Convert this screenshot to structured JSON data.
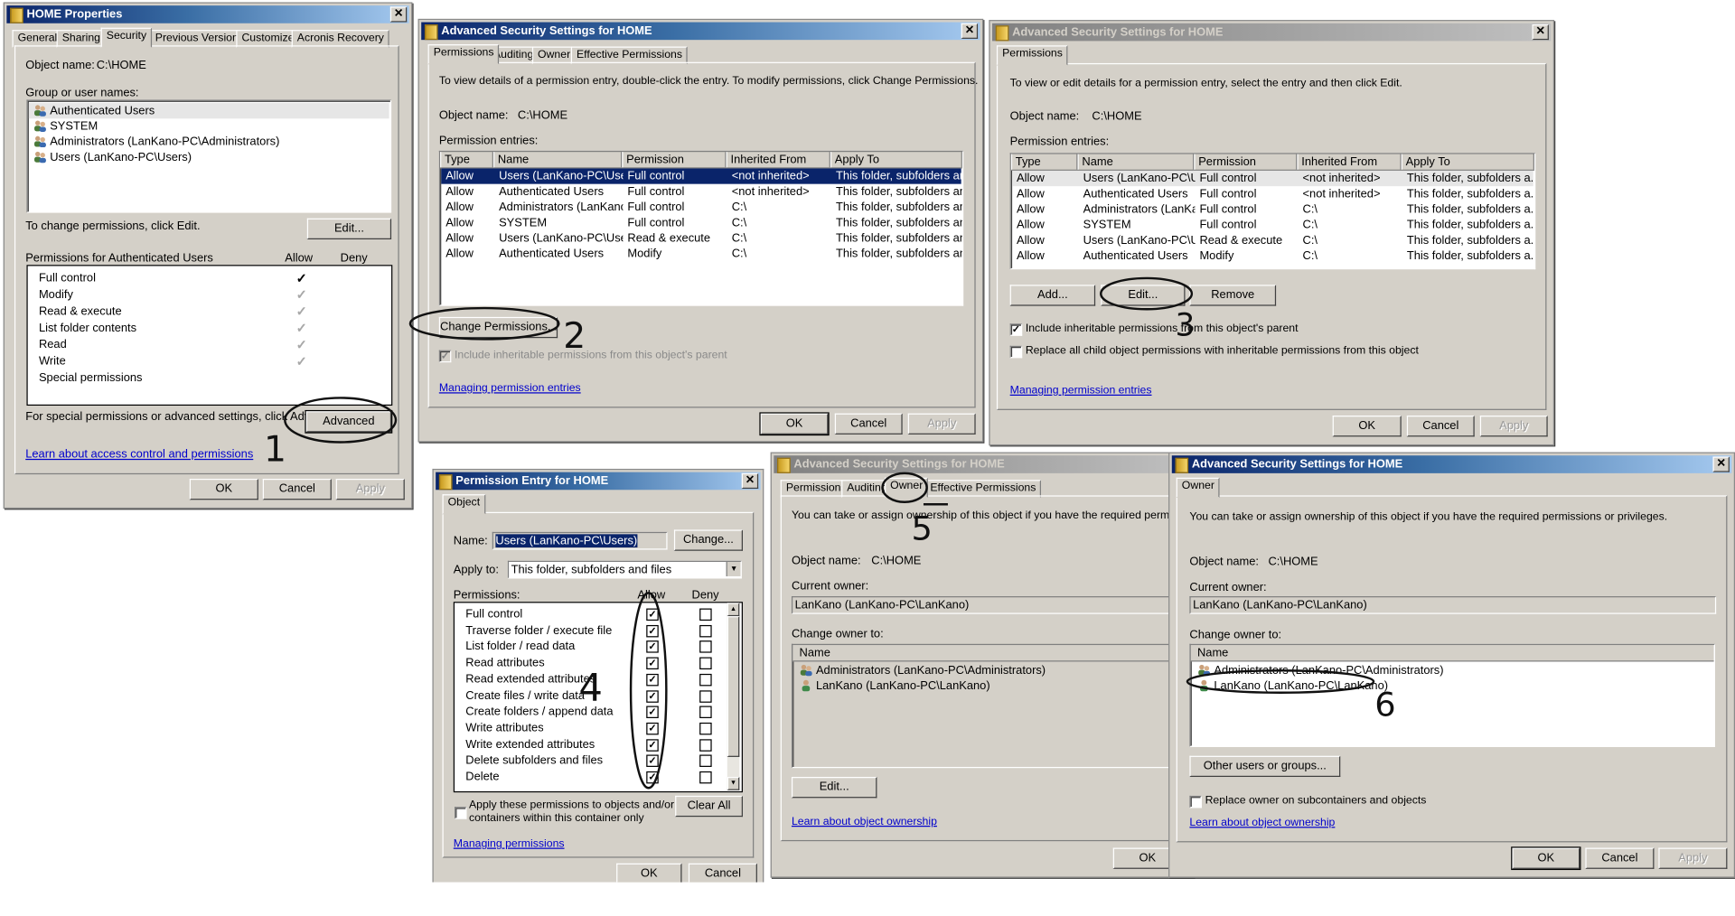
{
  "home_properties": {
    "title": "HOME Properties",
    "tabs": [
      "General",
      "Sharing",
      "Security",
      "Previous Versions",
      "Customize",
      "Acronis Recovery"
    ],
    "active_tab": "Security",
    "object_name_label": "Object name:",
    "object_name": "C:\\HOME",
    "group_label": "Group or user names:",
    "users": [
      "Authenticated Users",
      "SYSTEM",
      "Administrators (LanKano-PC\\Administrators)",
      "Users (LanKano-PC\\Users)"
    ],
    "change_hint": "To change permissions, click Edit.",
    "edit_button": "Edit...",
    "permissions_label": "Permissions for Authenticated Users",
    "allow_header": "Allow",
    "deny_header": "Deny",
    "permissions": [
      {
        "name": "Full control",
        "allow": "explicit"
      },
      {
        "name": "Modify",
        "allow": "inherited"
      },
      {
        "name": "Read & execute",
        "allow": "inherited"
      },
      {
        "name": "List folder contents",
        "allow": "inherited"
      },
      {
        "name": "Read",
        "allow": "inherited"
      },
      {
        "name": "Write",
        "allow": "inherited"
      },
      {
        "name": "Special permissions",
        "allow": "none"
      }
    ],
    "advanced_hint": "For special permissions or advanced settings, click Advanced.",
    "advanced_button": "Advanced",
    "help_link": "Learn about access control and permissions",
    "ok": "OK",
    "cancel": "Cancel",
    "apply": "Apply"
  },
  "adv_permissions": {
    "title": "Advanced Security Settings for HOME",
    "tabs": [
      "Permissions",
      "Auditing",
      "Owner",
      "Effective Permissions"
    ],
    "intro": "To view details of a permission entry, double-click the entry. To modify permissions, click Change Permissions.",
    "object_name_label": "Object name:",
    "object_name": "C:\\HOME",
    "entries_label": "Permission entries:",
    "columns": [
      "Type",
      "Name",
      "Permission",
      "Inherited From",
      "Apply To"
    ],
    "rows": [
      [
        "Allow",
        "Users (LanKano-PC\\Users)",
        "Full control",
        "<not inherited>",
        "This folder, subfolders and..."
      ],
      [
        "Allow",
        "Authenticated Users",
        "Full control",
        "<not inherited>",
        "This folder, subfolders and..."
      ],
      [
        "Allow",
        "Administrators (LanKano-...",
        "Full control",
        "C:\\",
        "This folder, subfolders and..."
      ],
      [
        "Allow",
        "SYSTEM",
        "Full control",
        "C:\\",
        "This folder, subfolders and..."
      ],
      [
        "Allow",
        "Users (LanKano-PC\\Users)",
        "Read & execute",
        "C:\\",
        "This folder, subfolders and..."
      ],
      [
        "Allow",
        "Authenticated Users",
        "Modify",
        "C:\\",
        "This folder, subfolders and..."
      ]
    ],
    "change_button": "Change Permissions...",
    "include_inheritable": "Include inheritable permissions from this object's parent",
    "link": "Managing permission entries",
    "ok": "OK",
    "cancel": "Cancel",
    "apply": "Apply"
  },
  "adv_permissions_edit": {
    "title": "Advanced Security Settings for HOME",
    "tabs": [
      "Permissions"
    ],
    "intro": "To view or edit details for a permission entry, select the entry and then click Edit.",
    "object_name_label": "Object name:",
    "object_name": "C:\\HOME",
    "entries_label": "Permission entries:",
    "columns": [
      "Type",
      "Name",
      "Permission",
      "Inherited From",
      "Apply To"
    ],
    "rows": [
      [
        "Allow",
        "Users (LanKano-PC\\Users)",
        "Full control",
        "<not inherited>",
        "This folder, subfolders a..."
      ],
      [
        "Allow",
        "Authenticated Users",
        "Full control",
        "<not inherited>",
        "This folder, subfolders a..."
      ],
      [
        "Allow",
        "Administrators (LanKano...",
        "Full control",
        "C:\\",
        "This folder, subfolders a..."
      ],
      [
        "Allow",
        "SYSTEM",
        "Full control",
        "C:\\",
        "This folder, subfolders a..."
      ],
      [
        "Allow",
        "Users (LanKano-PC\\Users)",
        "Read & execute",
        "C:\\",
        "This folder, subfolders a..."
      ],
      [
        "Allow",
        "Authenticated Users",
        "Modify",
        "C:\\",
        "This folder, subfolders a..."
      ]
    ],
    "add": "Add...",
    "edit": "Edit...",
    "remove": "Remove",
    "include_inheritable": "Include inheritable permissions from this object's parent",
    "replace_child": "Replace all child object permissions with inheritable permissions from this object",
    "link": "Managing permission entries",
    "ok": "OK",
    "cancel": "Cancel",
    "apply": "Apply"
  },
  "permission_entry": {
    "title": "Permission Entry for HOME",
    "tab": "Object",
    "name_label": "Name:",
    "name_value": "Users (LanKano-PC\\Users)",
    "change": "Change...",
    "apply_to_label": "Apply to:",
    "apply_to": "This folder, subfolders and files",
    "permissions_label": "Permissions:",
    "allow_header": "Allow",
    "deny_header": "Deny",
    "permissions": [
      {
        "name": "Full control",
        "allow": true,
        "deny": false
      },
      {
        "name": "Traverse folder / execute file",
        "allow": true,
        "deny": false
      },
      {
        "name": "List folder / read data",
        "allow": true,
        "deny": false
      },
      {
        "name": "Read attributes",
        "allow": true,
        "deny": false
      },
      {
        "name": "Read extended attributes",
        "allow": true,
        "deny": false
      },
      {
        "name": "Create files / write data",
        "allow": true,
        "deny": false
      },
      {
        "name": "Create folders / append data",
        "allow": true,
        "deny": false
      },
      {
        "name": "Write attributes",
        "allow": true,
        "deny": false
      },
      {
        "name": "Write extended attributes",
        "allow": true,
        "deny": false
      },
      {
        "name": "Delete subfolders and files",
        "allow": true,
        "deny": false
      },
      {
        "name": "Delete",
        "allow": true,
        "deny": false
      }
    ],
    "apply_only_line1": "Apply these permissions to objects and/or",
    "apply_only_line2": "containers within this container only",
    "clear_all": "Clear All",
    "link": "Managing permissions",
    "ok": "OK",
    "cancel": "Cancel"
  },
  "adv_owner_tab": {
    "title": "Advanced Security Settings for HOME",
    "tabs": [
      "Permissions",
      "Auditing",
      "Owner",
      "Effective Permissions"
    ],
    "intro": "You can take or assign ownership of this object if you have the required permissions or p",
    "object_name_label": "Object name:",
    "object_name": "C:\\HOME",
    "current_owner_label": "Current owner:",
    "current_owner": "LanKano (LanKano-PC\\LanKano)",
    "change_owner_label": "Change owner to:",
    "name_header": "Name",
    "owners": [
      {
        "name": "Administrators (LanKano-PC\\Administrators)",
        "icon": "group"
      },
      {
        "name": "LanKano (LanKano-PC\\LanKano)",
        "icon": "user"
      }
    ],
    "edit": "Edit...",
    "link": "Learn about object ownership",
    "ok": "OK"
  },
  "owner_only": {
    "title": "Advanced Security Settings for HOME",
    "tab": "Owner",
    "intro": "You can take or assign ownership of this object if you have the required permissions or privileges.",
    "object_name_label": "Object name:",
    "object_name": "C:\\HOME",
    "current_owner_label": "Current owner:",
    "current_owner": "LanKano (LanKano-PC\\LanKano)",
    "change_owner_label": "Change owner to:",
    "name_header": "Name",
    "owners": [
      {
        "name": "Administrators (LanKano-PC\\Administrators)",
        "icon": "group"
      },
      {
        "name": "LanKano (LanKano-PC\\LanKano)",
        "icon": "user"
      }
    ],
    "other_users": "Other users or groups...",
    "replace_owner": "Replace owner on subcontainers and objects",
    "link": "Learn about object ownership",
    "ok": "OK",
    "cancel": "Cancel",
    "apply": "Apply"
  },
  "annotations": [
    "1",
    "2",
    "3",
    "4",
    "5",
    "6"
  ],
  "colors": {
    "title_active": "#0a246a",
    "title_inactive": "#808080",
    "dialog_bg": "#d4d0c8",
    "selection": "#0a246a",
    "link": "#0000cc"
  }
}
